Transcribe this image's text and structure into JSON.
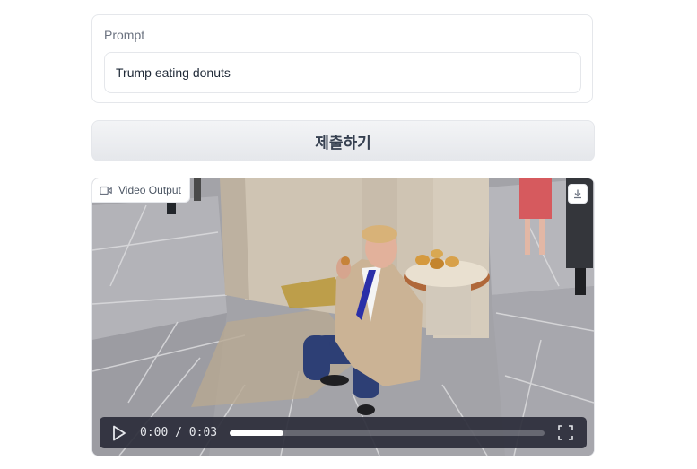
{
  "prompt": {
    "label": "Prompt",
    "value": "Trump eating donuts"
  },
  "submit": {
    "label": "제출하기"
  },
  "video": {
    "label": "Video Output",
    "label_icon": "video-camera-icon",
    "download_icon": "download-icon",
    "controls": {
      "play_icon": "play-icon",
      "time": "0:00 / 0:03",
      "progress": 0.17,
      "fullscreen_icon": "fullscreen-icon"
    }
  }
}
